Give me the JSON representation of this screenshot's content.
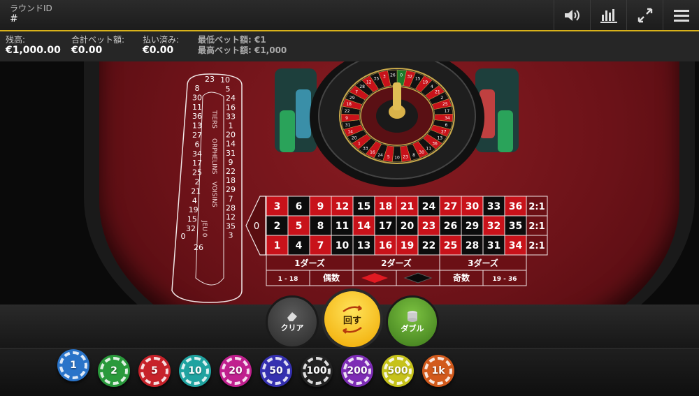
{
  "header": {
    "round_label": "ラウンドID",
    "round_value": "#"
  },
  "toolbar": {
    "icons": [
      "speaker-icon",
      "stats-icon",
      "fullscreen-icon",
      "menu-icon"
    ]
  },
  "info": {
    "balance_label": "残高:",
    "balance_value": "€1,000.00",
    "total_bet_label": "合計ベット額:",
    "total_bet_value": "€0.00",
    "paid_label": "払い済み:",
    "paid_value": "€0.00",
    "min_bet": "最低ベット額: €1",
    "max_bet": "最高ベット額: €1,000"
  },
  "racetrack": {
    "left_column": [
      "8",
      "30",
      "11",
      "36",
      "13",
      "27",
      "6",
      "34",
      "17",
      "25",
      "2",
      "21",
      "4",
      "19",
      "15",
      "32"
    ],
    "right_column": [
      "10",
      "5",
      "24",
      "16",
      "33",
      "1",
      "20",
      "14",
      "31",
      "9",
      "22",
      "18",
      "29",
      "7",
      "28",
      "12",
      "35",
      "3"
    ],
    "top": [
      "23"
    ],
    "bottom": [
      "0",
      "26"
    ],
    "sections": [
      "TIERS",
      "ORPHELINS",
      "VOISINS",
      "JEU 0"
    ]
  },
  "board": {
    "zero": "0",
    "rows": [
      [
        {
          "n": "3",
          "c": "r"
        },
        {
          "n": "6",
          "c": "b"
        },
        {
          "n": "9",
          "c": "r"
        },
        {
          "n": "12",
          "c": "r"
        },
        {
          "n": "15",
          "c": "b"
        },
        {
          "n": "18",
          "c": "r"
        },
        {
          "n": "21",
          "c": "r"
        },
        {
          "n": "24",
          "c": "b"
        },
        {
          "n": "27",
          "c": "r"
        },
        {
          "n": "30",
          "c": "r"
        },
        {
          "n": "33",
          "c": "b"
        },
        {
          "n": "36",
          "c": "r"
        }
      ],
      [
        {
          "n": "2",
          "c": "b"
        },
        {
          "n": "5",
          "c": "r"
        },
        {
          "n": "8",
          "c": "b"
        },
        {
          "n": "11",
          "c": "b"
        },
        {
          "n": "14",
          "c": "r"
        },
        {
          "n": "17",
          "c": "b"
        },
        {
          "n": "20",
          "c": "b"
        },
        {
          "n": "23",
          "c": "r"
        },
        {
          "n": "26",
          "c": "b"
        },
        {
          "n": "29",
          "c": "b"
        },
        {
          "n": "32",
          "c": "r"
        },
        {
          "n": "35",
          "c": "b"
        }
      ],
      [
        {
          "n": "1",
          "c": "r"
        },
        {
          "n": "4",
          "c": "b"
        },
        {
          "n": "7",
          "c": "r"
        },
        {
          "n": "10",
          "c": "b"
        },
        {
          "n": "13",
          "c": "b"
        },
        {
          "n": "16",
          "c": "r"
        },
        {
          "n": "19",
          "c": "r"
        },
        {
          "n": "22",
          "c": "b"
        },
        {
          "n": "25",
          "c": "r"
        },
        {
          "n": "28",
          "c": "b"
        },
        {
          "n": "31",
          "c": "b"
        },
        {
          "n": "34",
          "c": "r"
        }
      ]
    ],
    "column_bets": [
      "2:1",
      "2:1",
      "2:1"
    ],
    "dozens": [
      "1ダーズ",
      "2ダーズ",
      "3ダーズ"
    ],
    "outside": [
      "1 - 18",
      "偶数",
      "",
      "",
      "奇数",
      "19 - 36"
    ]
  },
  "wheel_numbers": [
    "0",
    "32",
    "15",
    "19",
    "4",
    "21",
    "2",
    "25",
    "17",
    "34",
    "6",
    "27",
    "13",
    "36",
    "11",
    "30",
    "8",
    "23",
    "10",
    "5",
    "24",
    "16",
    "33",
    "1",
    "20",
    "14",
    "31",
    "9",
    "22",
    "18",
    "29",
    "7",
    "28",
    "12",
    "35",
    "3",
    "26"
  ],
  "controls": {
    "clear_label": "クリア",
    "spin_label": "回す",
    "double_label": "ダブル"
  },
  "chips": [
    {
      "label": "1",
      "color": "#2a74c9"
    },
    {
      "label": "2",
      "color": "#2a9a3c"
    },
    {
      "label": "5",
      "color": "#c7222a"
    },
    {
      "label": "10",
      "color": "#1fa3a0"
    },
    {
      "label": "20",
      "color": "#c0208e"
    },
    {
      "label": "50",
      "color": "#3530b0"
    },
    {
      "label": "100",
      "color": "#222222"
    },
    {
      "label": "200",
      "color": "#7d2cb5"
    },
    {
      "label": "500",
      "color": "#c6c21a"
    },
    {
      "label": "1k",
      "color": "#d25a1c"
    }
  ]
}
